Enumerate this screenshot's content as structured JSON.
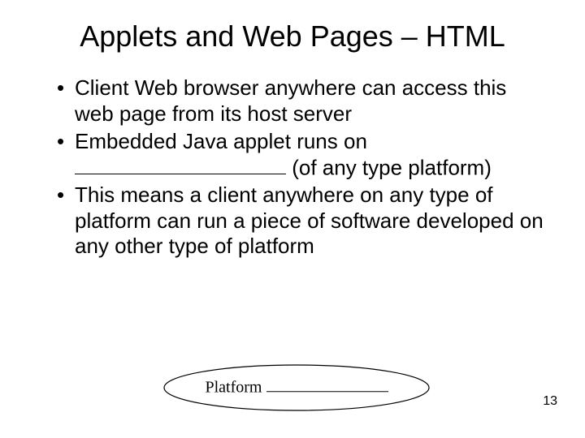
{
  "slide": {
    "title": "Applets and Web Pages – HTML",
    "bullets": [
      {
        "pre": "Client Web browser anywhere can access this web page from its host server",
        "post": ""
      },
      {
        "pre": "Embedded Java applet runs on ",
        "post": " (of any type platform)"
      },
      {
        "pre": "This means a client anywhere on any type of platform can run a piece of software developed on any other type of platform",
        "post": ""
      }
    ],
    "callout": {
      "label": "Platform "
    },
    "page_number": "13"
  }
}
